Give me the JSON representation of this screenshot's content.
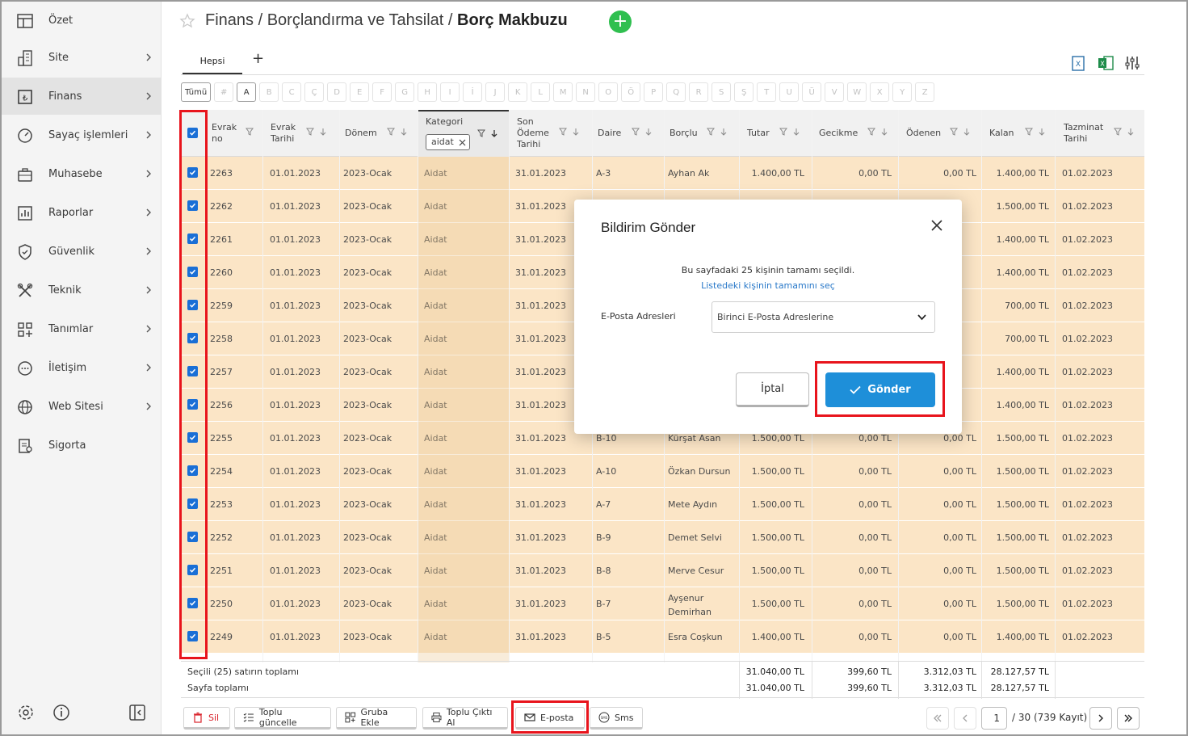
{
  "sidebar": {
    "items": [
      {
        "label": "Özet",
        "icon": "layout-icon"
      },
      {
        "label": "Site",
        "icon": "building-icon"
      },
      {
        "label": "Finans",
        "icon": "lira-icon"
      },
      {
        "label": "Sayaç işlemleri",
        "icon": "gauge-icon"
      },
      {
        "label": "Muhasebe",
        "icon": "briefcase-icon"
      },
      {
        "label": "Raporlar",
        "icon": "bar-chart-icon"
      },
      {
        "label": "Güvenlik",
        "icon": "shield-icon"
      },
      {
        "label": "Teknik",
        "icon": "tools-icon"
      },
      {
        "label": "Tanımlar",
        "icon": "grid-plus-icon"
      },
      {
        "label": "İletişim",
        "icon": "chat-icon"
      },
      {
        "label": "Web Sitesi",
        "icon": "globe-icon"
      },
      {
        "label": "Sigorta",
        "icon": "document-icon"
      }
    ]
  },
  "header": {
    "breadcrumb_prefix": "Finans / Borçlandırma ve Tahsilat / ",
    "breadcrumb_current": "Borç Makbuzu",
    "add": "+"
  },
  "tabs": {
    "hepsi": "Hepsi",
    "add": "+"
  },
  "letters": [
    "Tümü",
    "#",
    "A",
    "B",
    "C",
    "Ç",
    "D",
    "E",
    "F",
    "G",
    "H",
    "I",
    "İ",
    "J",
    "K",
    "L",
    "M",
    "N",
    "O",
    "Ö",
    "P",
    "Q",
    "R",
    "S",
    "Ş",
    "T",
    "U",
    "Ü",
    "V",
    "W",
    "X",
    "Y",
    "Z"
  ],
  "columns": {
    "evrak_no": [
      "Evrak",
      "no"
    ],
    "evrak_tarihi": [
      "Evrak",
      "Tarihi"
    ],
    "donem": "Dönem",
    "kategori": "Kategori",
    "kategori_filter": "aidat",
    "son_odeme": [
      "Son",
      "Ödeme",
      "Tarihi"
    ],
    "daire": "Daire",
    "borclu": "Borçlu",
    "tutar": "Tutar",
    "gecikme": "Gecikme",
    "odenen": "Ödenen",
    "kalan": "Kalan",
    "tazminat": [
      "Tazminat",
      "Tarihi"
    ]
  },
  "rows": [
    {
      "no": "2263",
      "tarih": "01.01.2023",
      "donem": "2023-Ocak",
      "kat": "Aidat",
      "son": "31.01.2023",
      "daire": "A-3",
      "borclu": "Ayhan Ak",
      "tutar": "1.400,00 TL",
      "gecikme": "0,00 TL",
      "odenen": "0,00 TL",
      "kalan": "1.400,00 TL",
      "taz": "01.02.2023"
    },
    {
      "no": "2262",
      "tarih": "01.01.2023",
      "donem": "2023-Ocak",
      "kat": "Aidat",
      "son": "31.01.2023",
      "daire": "",
      "borclu": "",
      "tutar": "",
      "gecikme": "",
      "odenen": "",
      "kalan": "1.500,00 TL",
      "taz": "01.02.2023"
    },
    {
      "no": "2261",
      "tarih": "01.01.2023",
      "donem": "2023-Ocak",
      "kat": "Aidat",
      "son": "31.01.2023",
      "daire": "",
      "borclu": "",
      "tutar": "",
      "gecikme": "",
      "odenen": "",
      "kalan": "1.400,00 TL",
      "taz": "01.02.2023"
    },
    {
      "no": "2260",
      "tarih": "01.01.2023",
      "donem": "2023-Ocak",
      "kat": "Aidat",
      "son": "31.01.2023",
      "daire": "",
      "borclu": "",
      "tutar": "",
      "gecikme": "",
      "odenen": "",
      "kalan": "1.400,00 TL",
      "taz": "01.02.2023"
    },
    {
      "no": "2259",
      "tarih": "01.01.2023",
      "donem": "2023-Ocak",
      "kat": "Aidat",
      "son": "31.01.2023",
      "daire": "",
      "borclu": "",
      "tutar": "",
      "gecikme": "",
      "odenen": "",
      "kalan": "700,00 TL",
      "taz": "01.02.2023"
    },
    {
      "no": "2258",
      "tarih": "01.01.2023",
      "donem": "2023-Ocak",
      "kat": "Aidat",
      "son": "31.01.2023",
      "daire": "",
      "borclu": "",
      "tutar": "",
      "gecikme": "",
      "odenen": "",
      "kalan": "700,00 TL",
      "taz": "01.02.2023"
    },
    {
      "no": "2257",
      "tarih": "01.01.2023",
      "donem": "2023-Ocak",
      "kat": "Aidat",
      "son": "31.01.2023",
      "daire": "",
      "borclu": "",
      "tutar": "",
      "gecikme": "",
      "odenen": "",
      "kalan": "1.400,00 TL",
      "taz": "01.02.2023"
    },
    {
      "no": "2256",
      "tarih": "01.01.2023",
      "donem": "2023-Ocak",
      "kat": "Aidat",
      "son": "31.01.2023",
      "daire": "",
      "borclu": "",
      "tutar": "",
      "gecikme": "",
      "odenen": "",
      "kalan": "1.400,00 TL",
      "taz": "01.02.2023"
    },
    {
      "no": "2255",
      "tarih": "01.01.2023",
      "donem": "2023-Ocak",
      "kat": "Aidat",
      "son": "31.01.2023",
      "daire": "B-10",
      "borclu": "Kürşat Asan",
      "tutar": "1.500,00 TL",
      "gecikme": "0,00 TL",
      "odenen": "0,00 TL",
      "kalan": "1.500,00 TL",
      "taz": "01.02.2023"
    },
    {
      "no": "2254",
      "tarih": "01.01.2023",
      "donem": "2023-Ocak",
      "kat": "Aidat",
      "son": "31.01.2023",
      "daire": "A-10",
      "borclu": "Özkan Dursun",
      "tutar": "1.500,00 TL",
      "gecikme": "0,00 TL",
      "odenen": "0,00 TL",
      "kalan": "1.500,00 TL",
      "taz": "01.02.2023"
    },
    {
      "no": "2253",
      "tarih": "01.01.2023",
      "donem": "2023-Ocak",
      "kat": "Aidat",
      "son": "31.01.2023",
      "daire": "A-7",
      "borclu": "Mete Aydın",
      "tutar": "1.500,00 TL",
      "gecikme": "0,00 TL",
      "odenen": "0,00 TL",
      "kalan": "1.500,00 TL",
      "taz": "01.02.2023"
    },
    {
      "no": "2252",
      "tarih": "01.01.2023",
      "donem": "2023-Ocak",
      "kat": "Aidat",
      "son": "31.01.2023",
      "daire": "B-9",
      "borclu": "Demet Selvi",
      "tutar": "1.500,00 TL",
      "gecikme": "0,00 TL",
      "odenen": "0,00 TL",
      "kalan": "1.500,00 TL",
      "taz": "01.02.2023"
    },
    {
      "no": "2251",
      "tarih": "01.01.2023",
      "donem": "2023-Ocak",
      "kat": "Aidat",
      "son": "31.01.2023",
      "daire": "B-8",
      "borclu": "Merve Cesur",
      "tutar": "1.500,00 TL",
      "gecikme": "0,00 TL",
      "odenen": "0,00 TL",
      "kalan": "1.500,00 TL",
      "taz": "01.02.2023"
    },
    {
      "no": "2250",
      "tarih": "01.01.2023",
      "donem": "2023-Ocak",
      "kat": "Aidat",
      "son": "31.01.2023",
      "daire": "B-7",
      "borclu": "Ayşenur\nDemirhan",
      "tutar": "1.500,00 TL",
      "gecikme": "0,00 TL",
      "odenen": "0,00 TL",
      "kalan": "1.500,00 TL",
      "taz": "01.02.2023"
    },
    {
      "no": "2249",
      "tarih": "01.01.2023",
      "donem": "2023-Ocak",
      "kat": "Aidat",
      "son": "31.01.2023",
      "daire": "B-5",
      "borclu": "Esra Coşkun",
      "tutar": "1.400,00 TL",
      "gecikme": "0,00 TL",
      "odenen": "0,00 TL",
      "kalan": "1.400,00 TL",
      "taz": "01.02.2023"
    }
  ],
  "totals": {
    "selected_label": "Seçili (25) satırın toplamı",
    "page_label": "Sayfa toplamı",
    "selected": {
      "tutar": "31.040,00 TL",
      "gecikme": "399,60 TL",
      "odenen": "3.312,03 TL",
      "kalan": "28.127,57 TL"
    },
    "page": {
      "tutar": "31.040,00 TL",
      "gecikme": "399,60 TL",
      "odenen": "3.312,03 TL",
      "kalan": "28.127,57 TL"
    }
  },
  "actions": {
    "sil": "Sil",
    "toplu_guncelle": "Toplu güncelle",
    "gruba_ekle": "Gruba Ekle",
    "toplu_cikti": "Toplu Çıktı Al",
    "eposta": "E-posta",
    "sms": "Sms"
  },
  "pager": {
    "page": "1",
    "info": "/ 30 (739 Kayıt)"
  },
  "modal": {
    "title": "Bildirim Gönder",
    "message": "Bu sayfadaki 25 kişinin tamamı seçildi.",
    "link": "Listedeki kişinin tamamını seç",
    "field_label": "E-Posta Adresleri",
    "select_value": "Birinci E-Posta Adreslerine",
    "cancel": "İptal",
    "send": "Gönder"
  },
  "colors": {
    "accent": "#1e8fd9",
    "add": "#2fbf4f",
    "row": "#fbe5c6",
    "highlight": "#e8141c",
    "check": "#1a6fd6"
  }
}
